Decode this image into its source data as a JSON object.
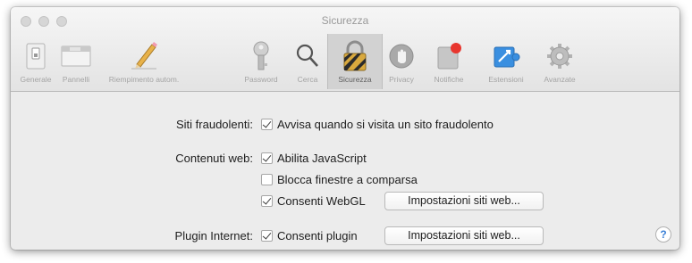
{
  "window": {
    "title": "Sicurezza"
  },
  "toolbar": {
    "tabs": [
      {
        "label": "Generale",
        "icon": "general-switch-icon"
      },
      {
        "label": "Pannelli",
        "icon": "tabs-panel-icon"
      },
      {
        "label": "Riempimento autom.",
        "icon": "pencil-autofill-icon"
      },
      {
        "label": "Password",
        "icon": "key-icon"
      },
      {
        "label": "Cerca",
        "icon": "magnifier-icon"
      },
      {
        "label": "Sicurezza",
        "icon": "padlock-icon",
        "active": true
      },
      {
        "label": "Privacy",
        "icon": "hand-privacy-icon"
      },
      {
        "label": "Notifiche",
        "icon": "notifications-icon"
      },
      {
        "label": "Estensioni",
        "icon": "extensions-puzzle-icon"
      },
      {
        "label": "Avanzate",
        "icon": "gear-icon"
      }
    ]
  },
  "security": {
    "fraudulent": {
      "label": "Siti fraudolenti:",
      "warn": {
        "label": "Avvisa quando si visita un sito fraudolento",
        "checked": true
      }
    },
    "web_content": {
      "label": "Contenuti web:",
      "javascript": {
        "label": "Abilita JavaScript",
        "checked": true
      },
      "block_popups": {
        "label": "Blocca finestre a comparsa",
        "checked": false
      },
      "webgl": {
        "label": "Consenti WebGL",
        "checked": true
      },
      "webgl_settings_button": "Impostazioni siti web..."
    },
    "plugins": {
      "label": "Plugin Internet:",
      "allow": {
        "label": "Consenti plugin",
        "checked": true
      },
      "plugin_settings_button": "Impostazioni siti web..."
    }
  },
  "help": {
    "label": "?"
  },
  "colors": {
    "accent": "#3b80d6",
    "active_tab_bg": "#d2d2d2",
    "window_bg": "#ececec"
  }
}
